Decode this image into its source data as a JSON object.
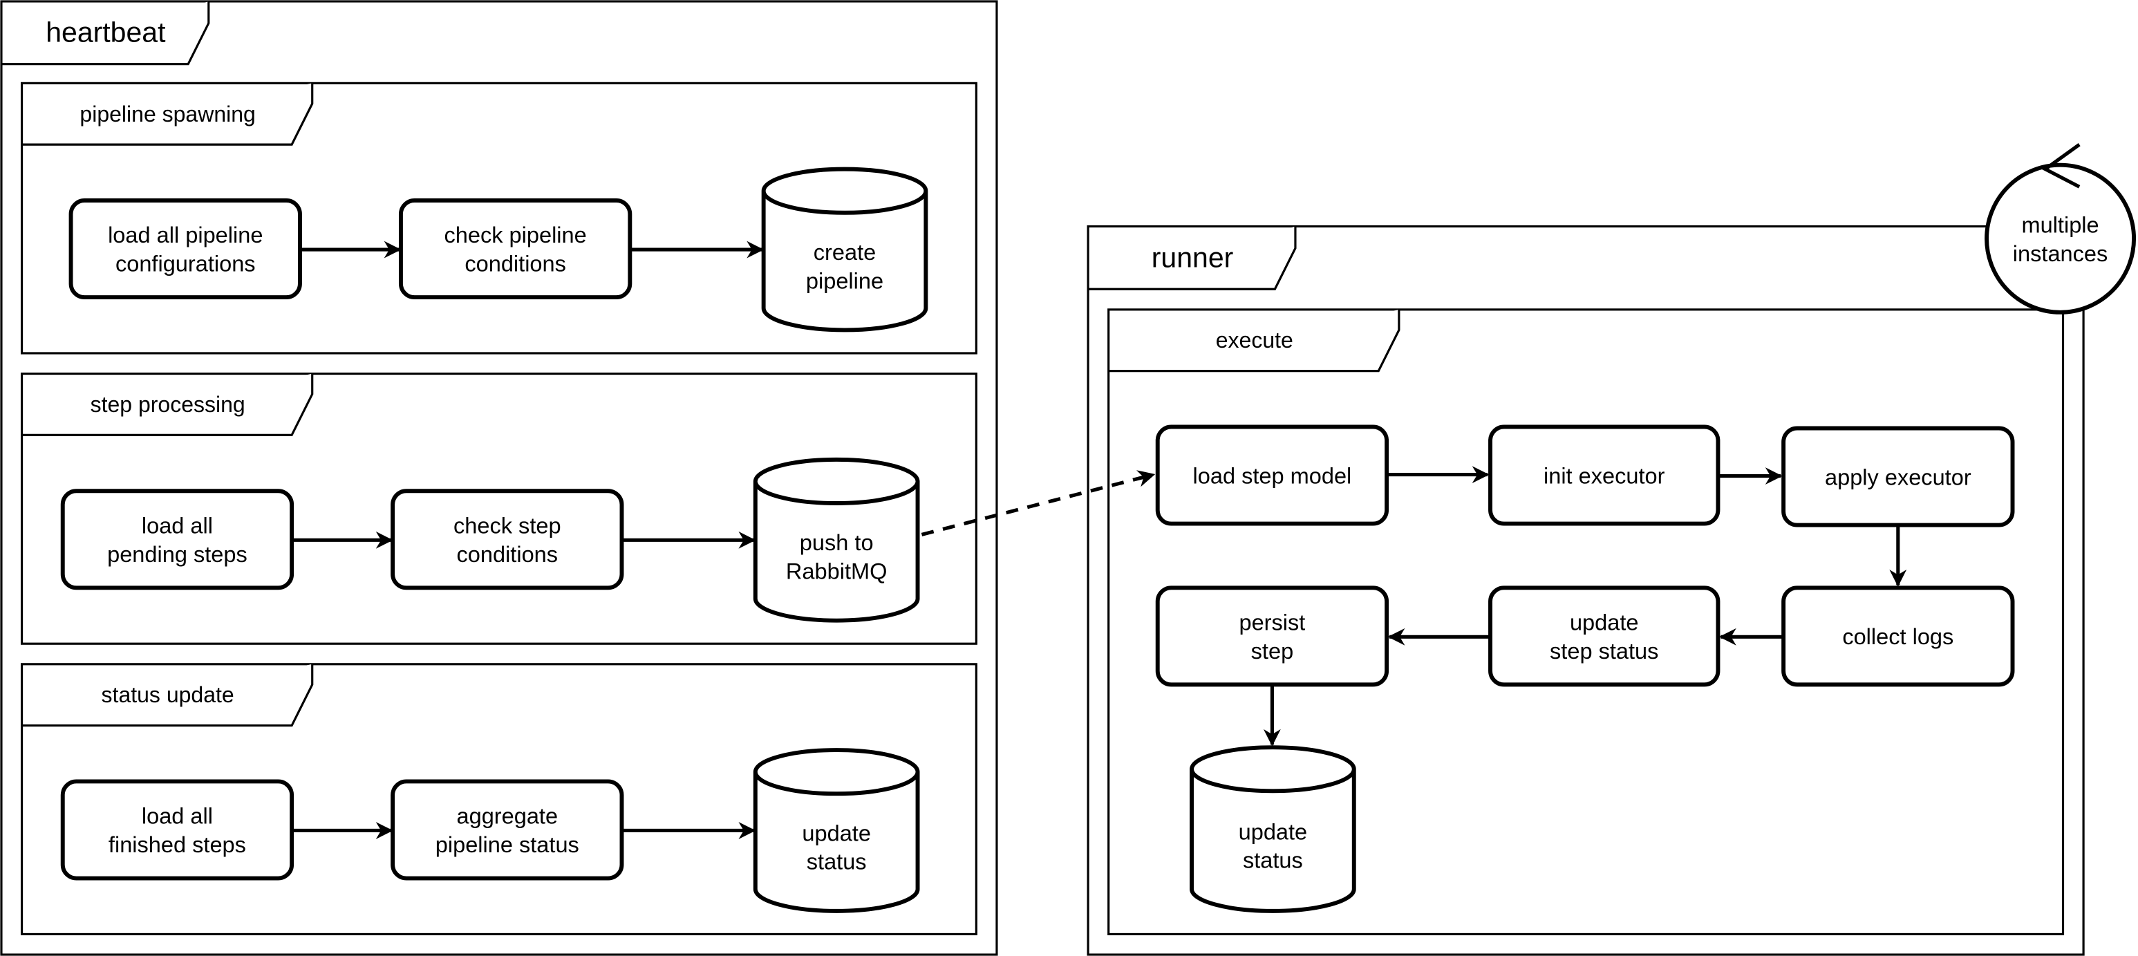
{
  "heartbeat": {
    "title": "heartbeat",
    "sections": [
      {
        "title": "pipeline spawning",
        "steps": [
          [
            "load all pipeline",
            "configurations"
          ],
          [
            "check pipeline",
            "conditions"
          ]
        ],
        "store": [
          "create",
          "pipeline"
        ]
      },
      {
        "title": "step processing",
        "steps": [
          [
            "load all",
            "pending steps"
          ],
          [
            "check step",
            "conditions"
          ]
        ],
        "store": [
          "push to",
          "RabbitMQ"
        ]
      },
      {
        "title": "status update",
        "steps": [
          [
            "load all",
            "finished steps"
          ],
          [
            "aggregate",
            "pipeline status"
          ]
        ],
        "store": [
          "update",
          "status"
        ]
      }
    ]
  },
  "runner": {
    "title": "runner",
    "badge": [
      "multiple",
      "instances"
    ],
    "execute": {
      "title": "execute",
      "steps": [
        [
          "load step model"
        ],
        [
          "init executor"
        ],
        [
          "apply executor"
        ],
        [
          "collect logs"
        ],
        [
          "update",
          "step status"
        ],
        [
          "persist",
          "step"
        ]
      ],
      "store": [
        "update",
        "status"
      ]
    }
  },
  "colors": {
    "stroke": "#000000",
    "fill": "#ffffff"
  }
}
